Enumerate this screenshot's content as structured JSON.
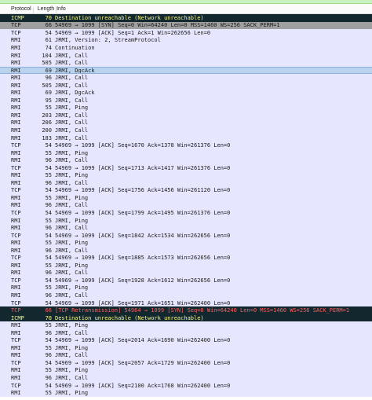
{
  "columns": {
    "protocol": "Protocol",
    "length": "Length",
    "info": "Info"
  },
  "colors": {
    "row_bg": "#e7e6ff",
    "icmp_bg": "#12272e",
    "icmp_fg": "#f7f787",
    "retrans_fg": "#ff5f5f",
    "syn_bg": "#a0a0a0",
    "selected_bg": "#b9d2ee"
  },
  "packets": [
    {
      "proto": "ICMP",
      "len": "70",
      "info": "Destination unreachable (Network unreachable)",
      "style": "icmp"
    },
    {
      "proto": "TCP",
      "len": "66",
      "info": "54969 → 1099 [SYN] Seq=0 Win=64240 Len=0 MSS=1460 WS=256 SACK_PERM=1",
      "style": "syn"
    },
    {
      "proto": "TCP",
      "len": "54",
      "info": "54969 → 1099 [ACK] Seq=1 Ack=1 Win=262656 Len=0",
      "style": ""
    },
    {
      "proto": "RMI",
      "len": "61",
      "info": "JRMI, Version: 2, StreamProtocol",
      "style": ""
    },
    {
      "proto": "RMI",
      "len": "74",
      "info": "Continuation",
      "style": ""
    },
    {
      "proto": "RMI",
      "len": "104",
      "info": "JRMI, Call",
      "style": ""
    },
    {
      "proto": "RMI",
      "len": "505",
      "info": "JRMI, Call",
      "style": ""
    },
    {
      "proto": "RMI",
      "len": "69",
      "info": "JRMI, DgcAck",
      "style": "sel"
    },
    {
      "proto": "RMI",
      "len": "96",
      "info": "JRMI, Call",
      "style": ""
    },
    {
      "proto": "RMI",
      "len": "505",
      "info": "JRMI, Call",
      "style": ""
    },
    {
      "proto": "RMI",
      "len": "69",
      "info": "JRMI, DgcAck",
      "style": ""
    },
    {
      "proto": "RMI",
      "len": "95",
      "info": "JRMI, Call",
      "style": ""
    },
    {
      "proto": "RMI",
      "len": "55",
      "info": "JRMI, Ping",
      "style": ""
    },
    {
      "proto": "RMI",
      "len": "203",
      "info": "JRMI, Call",
      "style": ""
    },
    {
      "proto": "RMI",
      "len": "206",
      "info": "JRMI, Call",
      "style": ""
    },
    {
      "proto": "RMI",
      "len": "200",
      "info": "JRMI, Call",
      "style": ""
    },
    {
      "proto": "RMI",
      "len": "183",
      "info": "JRMI, Call",
      "style": ""
    },
    {
      "proto": "TCP",
      "len": "54",
      "info": "54969 → 1099 [ACK] Seq=1670 Ack=1378 Win=261376 Len=0",
      "style": ""
    },
    {
      "proto": "RMI",
      "len": "55",
      "info": "JRMI, Ping",
      "style": ""
    },
    {
      "proto": "RMI",
      "len": "96",
      "info": "JRMI, Call",
      "style": ""
    },
    {
      "proto": "TCP",
      "len": "54",
      "info": "54969 → 1099 [ACK] Seq=1713 Ack=1417 Win=261376 Len=0",
      "style": ""
    },
    {
      "proto": "RMI",
      "len": "55",
      "info": "JRMI, Ping",
      "style": ""
    },
    {
      "proto": "RMI",
      "len": "96",
      "info": "JRMI, Call",
      "style": ""
    },
    {
      "proto": "TCP",
      "len": "54",
      "info": "54969 → 1099 [ACK] Seq=1756 Ack=1456 Win=261120 Len=0",
      "style": ""
    },
    {
      "proto": "RMI",
      "len": "55",
      "info": "JRMI, Ping",
      "style": ""
    },
    {
      "proto": "RMI",
      "len": "96",
      "info": "JRMI, Call",
      "style": ""
    },
    {
      "proto": "TCP",
      "len": "54",
      "info": "54969 → 1099 [ACK] Seq=1799 Ack=1495 Win=261376 Len=0",
      "style": ""
    },
    {
      "proto": "RMI",
      "len": "55",
      "info": "JRMI, Ping",
      "style": ""
    },
    {
      "proto": "RMI",
      "len": "96",
      "info": "JRMI, Call",
      "style": ""
    },
    {
      "proto": "TCP",
      "len": "54",
      "info": "54969 → 1099 [ACK] Seq=1842 Ack=1534 Win=262656 Len=0",
      "style": ""
    },
    {
      "proto": "RMI",
      "len": "55",
      "info": "JRMI, Ping",
      "style": ""
    },
    {
      "proto": "RMI",
      "len": "96",
      "info": "JRMI, Call",
      "style": ""
    },
    {
      "proto": "TCP",
      "len": "54",
      "info": "54969 → 1099 [ACK] Seq=1885 Ack=1573 Win=262656 Len=0",
      "style": ""
    },
    {
      "proto": "RMI",
      "len": "55",
      "info": "JRMI, Ping",
      "style": ""
    },
    {
      "proto": "RMI",
      "len": "96",
      "info": "JRMI, Call",
      "style": ""
    },
    {
      "proto": "TCP",
      "len": "54",
      "info": "54969 → 1099 [ACK] Seq=1928 Ack=1612 Win=262656 Len=0",
      "style": ""
    },
    {
      "proto": "RMI",
      "len": "55",
      "info": "JRMI, Ping",
      "style": ""
    },
    {
      "proto": "RMI",
      "len": "96",
      "info": "JRMI, Call",
      "style": ""
    },
    {
      "proto": "TCP",
      "len": "54",
      "info": "54969 → 1099 [ACK] Seq=1971 Ack=1651 Win=262400 Len=0",
      "style": ""
    },
    {
      "proto": "TCP",
      "len": "66",
      "info": "[TCP Retransmission] 54964 → 1099 [SYN] Seq=0 Win=64240 Len=0 MSS=1460 WS=256 SACK_PERM=1",
      "style": "retrans"
    },
    {
      "proto": "ICMP",
      "len": "70",
      "info": "Destination unreachable (Network unreachable)",
      "style": "icmp"
    },
    {
      "proto": "RMI",
      "len": "55",
      "info": "JRMI, Ping",
      "style": ""
    },
    {
      "proto": "RMI",
      "len": "96",
      "info": "JRMI, Call",
      "style": ""
    },
    {
      "proto": "TCP",
      "len": "54",
      "info": "54969 → 1099 [ACK] Seq=2014 Ack=1690 Win=262400 Len=0",
      "style": ""
    },
    {
      "proto": "RMI",
      "len": "55",
      "info": "JRMI, Ping",
      "style": ""
    },
    {
      "proto": "RMI",
      "len": "96",
      "info": "JRMI, Call",
      "style": ""
    },
    {
      "proto": "TCP",
      "len": "54",
      "info": "54969 → 1099 [ACK] Seq=2057 Ack=1729 Win=262400 Len=0",
      "style": ""
    },
    {
      "proto": "RMI",
      "len": "55",
      "info": "JRMI, Ping",
      "style": ""
    },
    {
      "proto": "RMI",
      "len": "96",
      "info": "JRMI, Call",
      "style": ""
    },
    {
      "proto": "TCP",
      "len": "54",
      "info": "54969 → 1099 [ACK] Seq=2100 Ack=1768 Win=262400 Len=0",
      "style": ""
    },
    {
      "proto": "RMI",
      "len": "55",
      "info": "JRMI, Ping",
      "style": ""
    }
  ]
}
